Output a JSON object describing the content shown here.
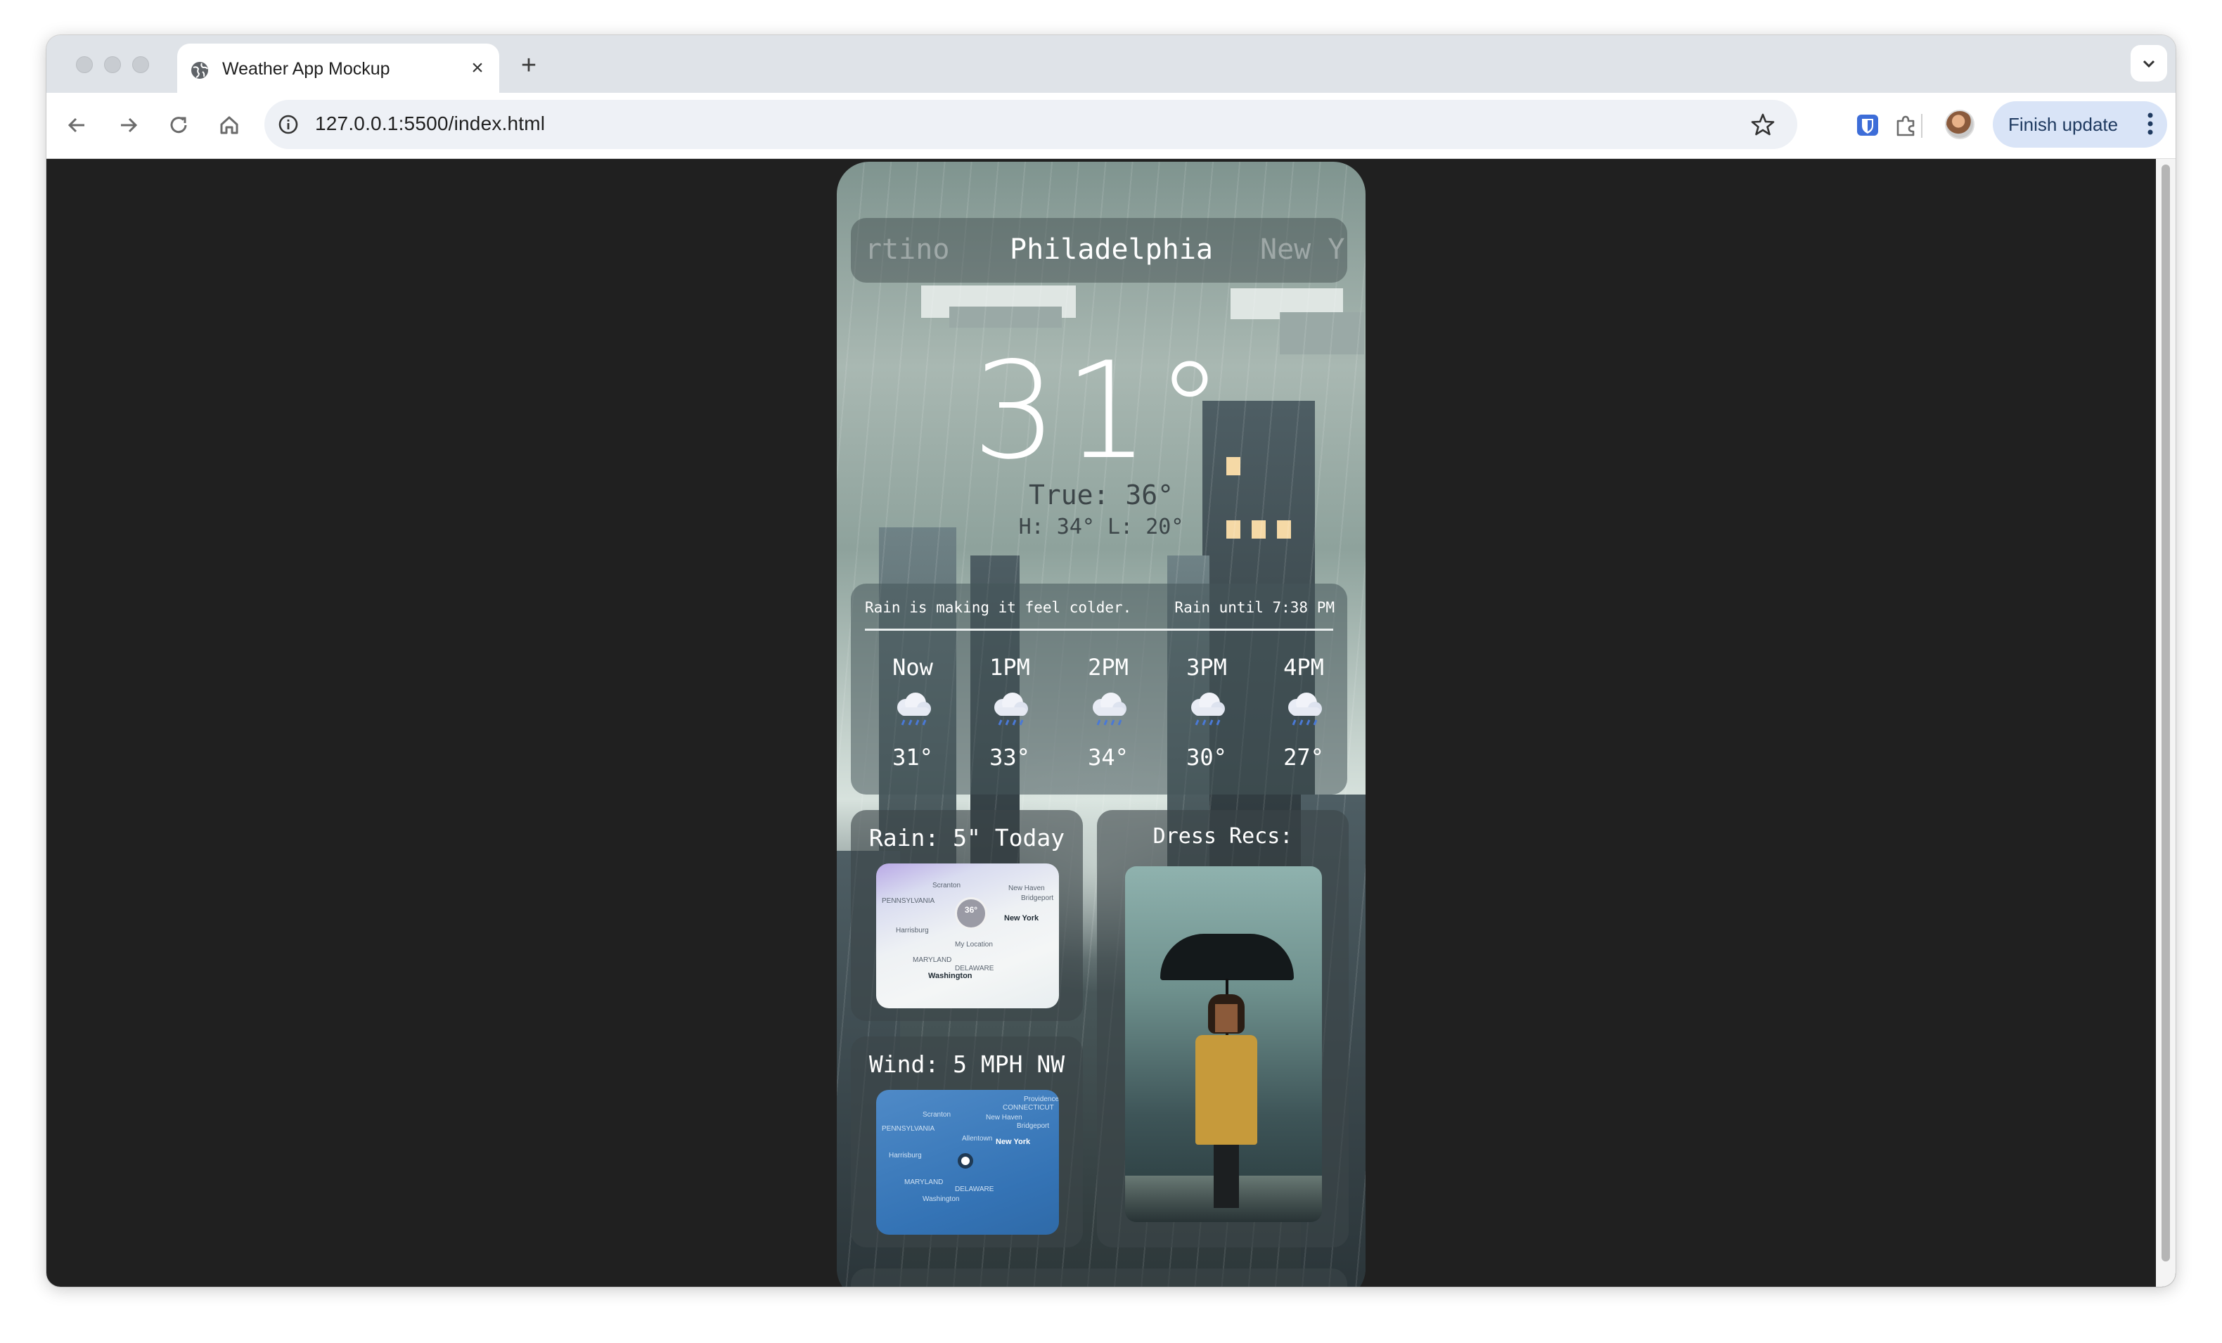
{
  "browser": {
    "tab_title": "Weather App Mockup",
    "url": "127.0.0.1:5500/index.html",
    "finish_update_label": "Finish update"
  },
  "weather": {
    "cities": {
      "previous": "rtino",
      "current": "Philadelphia",
      "next": "New Y"
    },
    "temperature": "31°",
    "feels_like": "True: 36°",
    "high_low": "H: 34° L: 20°",
    "summary": "Rain is making it feel colder.",
    "rain_until": "Rain until 7:38 PM",
    "hourly": [
      {
        "label": "Now",
        "icon": "rain-cloud-icon",
        "temp": "31°"
      },
      {
        "label": "1PM",
        "icon": "rain-cloud-icon",
        "temp": "33°"
      },
      {
        "label": "2PM",
        "icon": "rain-cloud-icon",
        "temp": "34°"
      },
      {
        "label": "3PM",
        "icon": "rain-cloud-icon",
        "temp": "30°"
      },
      {
        "label": "4PM",
        "icon": "rain-cloud-icon",
        "temp": "27°"
      }
    ],
    "rain_card": {
      "title": "Rain: 5\" Today",
      "map": {
        "pin_temp": "36°",
        "labels": [
          "Scranton",
          "New Haven",
          "Bridgeport",
          "New York",
          "Harrisburg",
          "My Location",
          "Washington",
          "PENNSYLVANIA",
          "MARYLAND",
          "DELAWARE"
        ]
      }
    },
    "wind_card": {
      "title": "Wind: 5 MPH NW",
      "map": {
        "labels": [
          "Scranton",
          "Providence",
          "New Haven",
          "Bridgeport",
          "Allentown",
          "New York",
          "Harrisburg",
          "Washington",
          "CONNECTICUT",
          "PENNSYLVANIA",
          "MARYLAND",
          "DELAWARE"
        ]
      }
    },
    "dress_card": {
      "title": "Dress Recs:"
    }
  },
  "colors": {
    "page_background": "#202020",
    "finish_update_bg": "#d9e4f7",
    "wind_map": "#3473b5",
    "rain_map_overlay": "#b9a9e6"
  }
}
